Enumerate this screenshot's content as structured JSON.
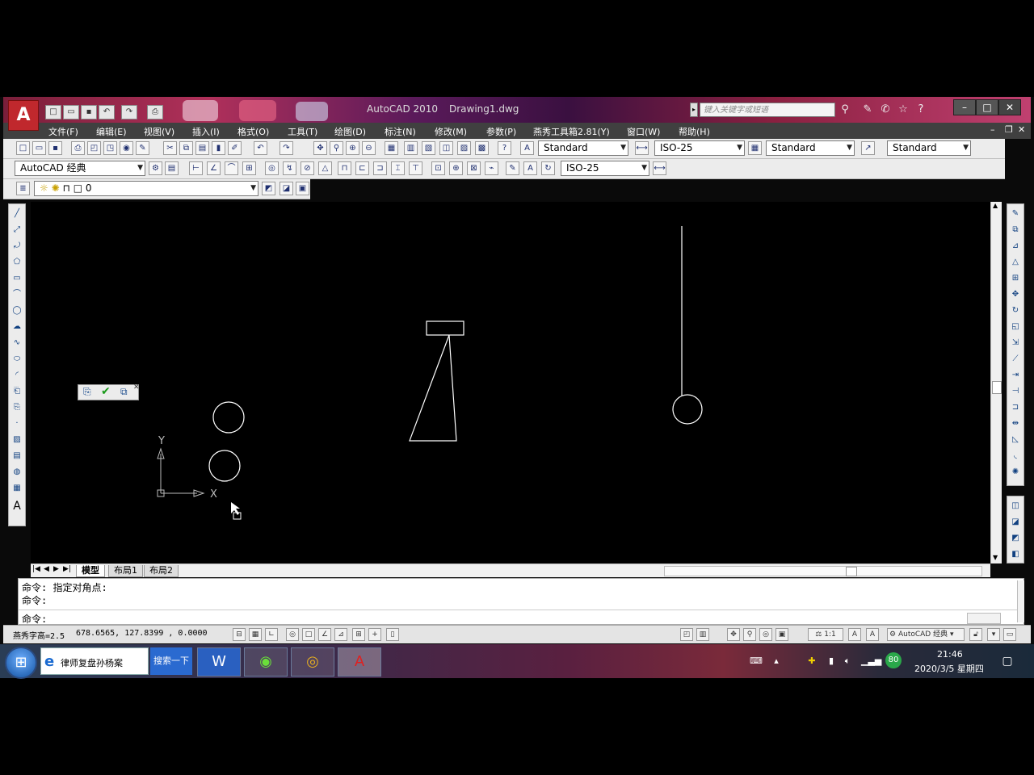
{
  "title": {
    "app_name": "AutoCAD 2010",
    "file_name": "Drawing1.dwg",
    "search_placeholder": "键入关键字或短语"
  },
  "menu": [
    "文件(F)",
    "编辑(E)",
    "视图(V)",
    "插入(I)",
    "格式(O)",
    "工具(T)",
    "绘图(D)",
    "标注(N)",
    "修改(M)",
    "参数(P)",
    "燕秀工具箱2.81(Y)",
    "窗口(W)",
    "帮助(H)"
  ],
  "styles_toolbar": {
    "text_style": "Standard",
    "dim_style": "ISO-25",
    "table_style": "Standard",
    "multileader_style": "Standard"
  },
  "workspace": {
    "name": "AutoCAD 经典",
    "dim_style2": "ISO-25"
  },
  "layer": {
    "current": "0"
  },
  "canvas": {
    "ucs_y_label": "Y",
    "ucs_x_label": "X"
  },
  "tabs": [
    "模型",
    "布局1",
    "布局2"
  ],
  "command": {
    "line1": "命令: 指定对角点:",
    "line2": "命令:",
    "line3": "命令:"
  },
  "status": {
    "text_height": "燕秀字高=2.5",
    "coords": "678.6565,  127.8399 , 0.0000",
    "scale": "1:1",
    "workspace_label": "AutoCAD 经典"
  },
  "taskbar": {
    "ie_label": "律师复盘孙杨案",
    "search_button": "搜索一下",
    "time": "21:46",
    "date": "2020/3/5 星期四",
    "badge": "80"
  },
  "colors": {
    "accent": "#c0282d",
    "canvas": "#000000",
    "entity": "#ffffff"
  }
}
